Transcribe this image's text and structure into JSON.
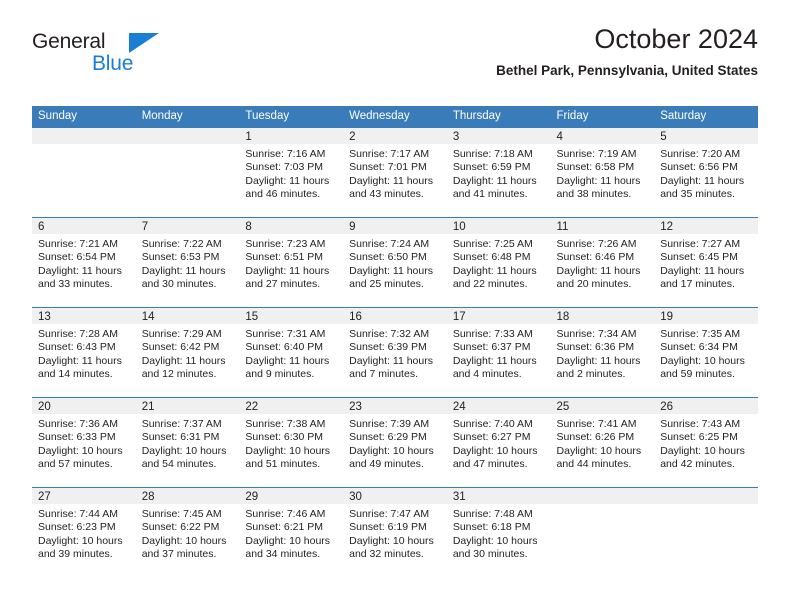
{
  "logo": {
    "word1": "General",
    "word2": "Blue",
    "accent_color": "#1a7fd4",
    "triangle_icon": "blue-triangle-icon"
  },
  "header": {
    "title": "October 2024",
    "subtitle": "Bethel Park, Pennsylvania, United States"
  },
  "calendar": {
    "header_color": "#3a7cba",
    "daynum_band_color": "#f0f0f0",
    "weekday_headers": [
      "Sunday",
      "Monday",
      "Tuesday",
      "Wednesday",
      "Thursday",
      "Friday",
      "Saturday"
    ],
    "labels": {
      "sunrise": "Sunrise:",
      "sunset": "Sunset:",
      "daylight": "Daylight:"
    },
    "weeks": [
      [
        {
          "day": "",
          "empty": true
        },
        {
          "day": "",
          "empty": true
        },
        {
          "day": "1",
          "sunrise": "Sunrise: 7:16 AM",
          "sunset": "Sunset: 7:03 PM",
          "daylight_1": "Daylight: 11 hours",
          "daylight_2": "and 46 minutes."
        },
        {
          "day": "2",
          "sunrise": "Sunrise: 7:17 AM",
          "sunset": "Sunset: 7:01 PM",
          "daylight_1": "Daylight: 11 hours",
          "daylight_2": "and 43 minutes."
        },
        {
          "day": "3",
          "sunrise": "Sunrise: 7:18 AM",
          "sunset": "Sunset: 6:59 PM",
          "daylight_1": "Daylight: 11 hours",
          "daylight_2": "and 41 minutes."
        },
        {
          "day": "4",
          "sunrise": "Sunrise: 7:19 AM",
          "sunset": "Sunset: 6:58 PM",
          "daylight_1": "Daylight: 11 hours",
          "daylight_2": "and 38 minutes."
        },
        {
          "day": "5",
          "sunrise": "Sunrise: 7:20 AM",
          "sunset": "Sunset: 6:56 PM",
          "daylight_1": "Daylight: 11 hours",
          "daylight_2": "and 35 minutes."
        }
      ],
      [
        {
          "day": "6",
          "sunrise": "Sunrise: 7:21 AM",
          "sunset": "Sunset: 6:54 PM",
          "daylight_1": "Daylight: 11 hours",
          "daylight_2": "and 33 minutes."
        },
        {
          "day": "7",
          "sunrise": "Sunrise: 7:22 AM",
          "sunset": "Sunset: 6:53 PM",
          "daylight_1": "Daylight: 11 hours",
          "daylight_2": "and 30 minutes."
        },
        {
          "day": "8",
          "sunrise": "Sunrise: 7:23 AM",
          "sunset": "Sunset: 6:51 PM",
          "daylight_1": "Daylight: 11 hours",
          "daylight_2": "and 27 minutes."
        },
        {
          "day": "9",
          "sunrise": "Sunrise: 7:24 AM",
          "sunset": "Sunset: 6:50 PM",
          "daylight_1": "Daylight: 11 hours",
          "daylight_2": "and 25 minutes."
        },
        {
          "day": "10",
          "sunrise": "Sunrise: 7:25 AM",
          "sunset": "Sunset: 6:48 PM",
          "daylight_1": "Daylight: 11 hours",
          "daylight_2": "and 22 minutes."
        },
        {
          "day": "11",
          "sunrise": "Sunrise: 7:26 AM",
          "sunset": "Sunset: 6:46 PM",
          "daylight_1": "Daylight: 11 hours",
          "daylight_2": "and 20 minutes."
        },
        {
          "day": "12",
          "sunrise": "Sunrise: 7:27 AM",
          "sunset": "Sunset: 6:45 PM",
          "daylight_1": "Daylight: 11 hours",
          "daylight_2": "and 17 minutes."
        }
      ],
      [
        {
          "day": "13",
          "sunrise": "Sunrise: 7:28 AM",
          "sunset": "Sunset: 6:43 PM",
          "daylight_1": "Daylight: 11 hours",
          "daylight_2": "and 14 minutes."
        },
        {
          "day": "14",
          "sunrise": "Sunrise: 7:29 AM",
          "sunset": "Sunset: 6:42 PM",
          "daylight_1": "Daylight: 11 hours",
          "daylight_2": "and 12 minutes."
        },
        {
          "day": "15",
          "sunrise": "Sunrise: 7:31 AM",
          "sunset": "Sunset: 6:40 PM",
          "daylight_1": "Daylight: 11 hours",
          "daylight_2": "and 9 minutes."
        },
        {
          "day": "16",
          "sunrise": "Sunrise: 7:32 AM",
          "sunset": "Sunset: 6:39 PM",
          "daylight_1": "Daylight: 11 hours",
          "daylight_2": "and 7 minutes."
        },
        {
          "day": "17",
          "sunrise": "Sunrise: 7:33 AM",
          "sunset": "Sunset: 6:37 PM",
          "daylight_1": "Daylight: 11 hours",
          "daylight_2": "and 4 minutes."
        },
        {
          "day": "18",
          "sunrise": "Sunrise: 7:34 AM",
          "sunset": "Sunset: 6:36 PM",
          "daylight_1": "Daylight: 11 hours",
          "daylight_2": "and 2 minutes."
        },
        {
          "day": "19",
          "sunrise": "Sunrise: 7:35 AM",
          "sunset": "Sunset: 6:34 PM",
          "daylight_1": "Daylight: 10 hours",
          "daylight_2": "and 59 minutes."
        }
      ],
      [
        {
          "day": "20",
          "sunrise": "Sunrise: 7:36 AM",
          "sunset": "Sunset: 6:33 PM",
          "daylight_1": "Daylight: 10 hours",
          "daylight_2": "and 57 minutes."
        },
        {
          "day": "21",
          "sunrise": "Sunrise: 7:37 AM",
          "sunset": "Sunset: 6:31 PM",
          "daylight_1": "Daylight: 10 hours",
          "daylight_2": "and 54 minutes."
        },
        {
          "day": "22",
          "sunrise": "Sunrise: 7:38 AM",
          "sunset": "Sunset: 6:30 PM",
          "daylight_1": "Daylight: 10 hours",
          "daylight_2": "and 51 minutes."
        },
        {
          "day": "23",
          "sunrise": "Sunrise: 7:39 AM",
          "sunset": "Sunset: 6:29 PM",
          "daylight_1": "Daylight: 10 hours",
          "daylight_2": "and 49 minutes."
        },
        {
          "day": "24",
          "sunrise": "Sunrise: 7:40 AM",
          "sunset": "Sunset: 6:27 PM",
          "daylight_1": "Daylight: 10 hours",
          "daylight_2": "and 47 minutes."
        },
        {
          "day": "25",
          "sunrise": "Sunrise: 7:41 AM",
          "sunset": "Sunset: 6:26 PM",
          "daylight_1": "Daylight: 10 hours",
          "daylight_2": "and 44 minutes."
        },
        {
          "day": "26",
          "sunrise": "Sunrise: 7:43 AM",
          "sunset": "Sunset: 6:25 PM",
          "daylight_1": "Daylight: 10 hours",
          "daylight_2": "and 42 minutes."
        }
      ],
      [
        {
          "day": "27",
          "sunrise": "Sunrise: 7:44 AM",
          "sunset": "Sunset: 6:23 PM",
          "daylight_1": "Daylight: 10 hours",
          "daylight_2": "and 39 minutes."
        },
        {
          "day": "28",
          "sunrise": "Sunrise: 7:45 AM",
          "sunset": "Sunset: 6:22 PM",
          "daylight_1": "Daylight: 10 hours",
          "daylight_2": "and 37 minutes."
        },
        {
          "day": "29",
          "sunrise": "Sunrise: 7:46 AM",
          "sunset": "Sunset: 6:21 PM",
          "daylight_1": "Daylight: 10 hours",
          "daylight_2": "and 34 minutes."
        },
        {
          "day": "30",
          "sunrise": "Sunrise: 7:47 AM",
          "sunset": "Sunset: 6:19 PM",
          "daylight_1": "Daylight: 10 hours",
          "daylight_2": "and 32 minutes."
        },
        {
          "day": "31",
          "sunrise": "Sunrise: 7:48 AM",
          "sunset": "Sunset: 6:18 PM",
          "daylight_1": "Daylight: 10 hours",
          "daylight_2": "and 30 minutes."
        },
        {
          "day": "",
          "empty": true
        },
        {
          "day": "",
          "empty": true
        }
      ]
    ]
  }
}
